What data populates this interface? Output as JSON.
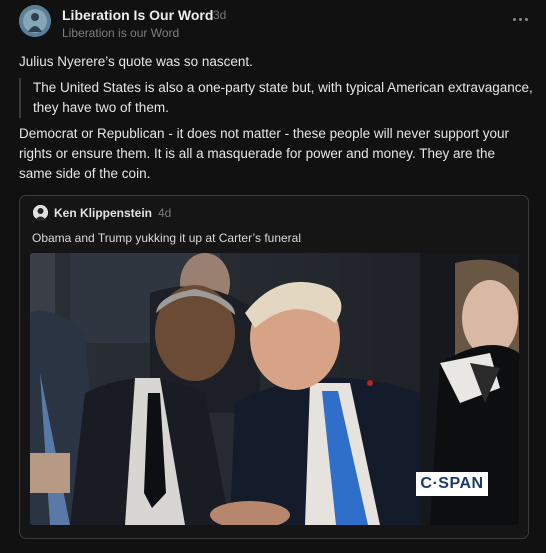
{
  "post": {
    "author_name": "Liberation Is Our Word",
    "age": "3d",
    "author_handle": "Liberation is our Word",
    "more_icon": "more-horizontal-icon",
    "paragraph1": "Julius Nyerere’s quote was so nascent.",
    "quote": "The United States is also a one-party state but, with typical American extravagance, they have two of them.",
    "paragraph2": "Democrat or Republican - it does not matter - these people will never support your rights or ensure them. It is all a masquerade for power and money. They are the same side of the coin."
  },
  "embed": {
    "author_name": "Ken Klippenstein",
    "age": "4d",
    "text": "Obama and Trump yukking it up at Carter’s funeral",
    "media_watermark": "C·SPAN"
  },
  "colors": {
    "background": "#111112",
    "card_border": "#3a3a3c",
    "muted_text": "#7d7d7d",
    "tie_blue": "#2f6fc9"
  }
}
